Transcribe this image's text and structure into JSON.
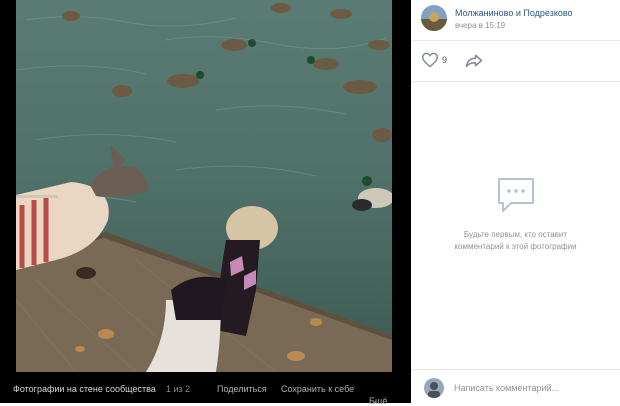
{
  "post": {
    "group_name": "Молжаниново и Подрезково",
    "time": "вчера в 15:19",
    "likes": "9"
  },
  "bottom_bar": {
    "album_title": "Фотографии на стене сообщества",
    "counter": "1 из 2",
    "share_label": "Поделиться",
    "save_label": "Сохранить к себе",
    "more_label": "Ещё"
  },
  "comments": {
    "empty_line1": "Будьте первым, кто оставит",
    "empty_line2": "комментарий к этой фотографии",
    "placeholder": "Написать комментарий..."
  },
  "icons": {
    "like": "heart-icon",
    "share": "share-arrow-icon",
    "comment": "speech-bubble-icon",
    "more": "chevron-down-icon"
  },
  "colors": {
    "link": "#2a5885",
    "muted": "#939393",
    "photo_bg": "#000000"
  }
}
